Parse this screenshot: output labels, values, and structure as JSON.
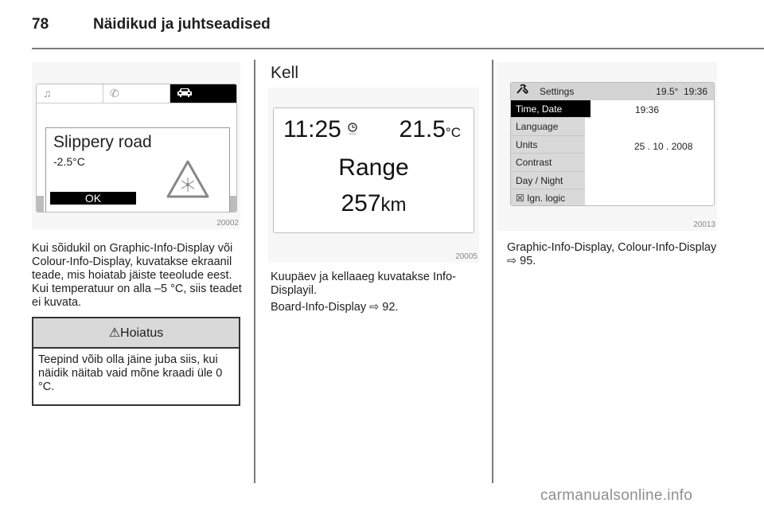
{
  "header": {
    "page_number": "78",
    "chapter_title": "Näidikud ja juhtseadised"
  },
  "left_column": {
    "figure": {
      "id": "20002",
      "tabs": [
        {
          "icon": "music-note-icon",
          "glyph": "♫",
          "active": false
        },
        {
          "icon": "phone-icon",
          "glyph": "✆",
          "active": false
        },
        {
          "icon": "car-icon",
          "glyph": "🚘",
          "active": true
        }
      ],
      "message_title": "Slippery road",
      "message_temp": "-2.5°C",
      "ok_label": "OK",
      "warning_icon": "snowflake-warning-triangle-icon"
    },
    "paragraph": "Kui sõidukil on Graphic-Info-Display või Colour-Info-Display, kuvatakse ekraanil teade, mis hoiatab jäiste teeolude eest. Kui temperatuur on alla –5 °C, siis teadet ei kuvata.",
    "warning_box": {
      "icon": "⚠",
      "title": "Hoiatus",
      "text": "Teepind võib olla jäine juba siis, kui näidik näitab vaid mõne kraadi üle 0 °C."
    }
  },
  "middle_column": {
    "section_title": "Kell",
    "figure": {
      "id": "20005",
      "time": "11:25",
      "clock_icon_label": "RDS",
      "temperature": "21.5",
      "temperature_unit": "°C",
      "range_label": "Range",
      "range_value": "257",
      "range_unit": "km"
    },
    "paragraph1": "Kuupäev ja kellaaeg kuvatakse Info-Displayil.",
    "paragraph2": "Board-Info-Display ⇨ 92."
  },
  "right_column": {
    "figure": {
      "id": "20013",
      "header_title": "Settings",
      "header_temp": "19.5°",
      "header_time": "19:36",
      "menu_items": [
        {
          "label": "Time, Date",
          "selected": true
        },
        {
          "label": "Language",
          "selected": false
        },
        {
          "label": "Units",
          "selected": false
        },
        {
          "label": "Contrast",
          "selected": false
        },
        {
          "label": "Day / Night",
          "selected": false
        },
        {
          "label": "☒ Ign. logic",
          "selected": false
        }
      ],
      "value_time": "19:36",
      "value_date": "25 . 10 . 2008"
    },
    "paragraph": "Graphic-Info-Display, Colour-Info-Display ⇨ 95."
  },
  "watermark": "carmanualsonline.info"
}
